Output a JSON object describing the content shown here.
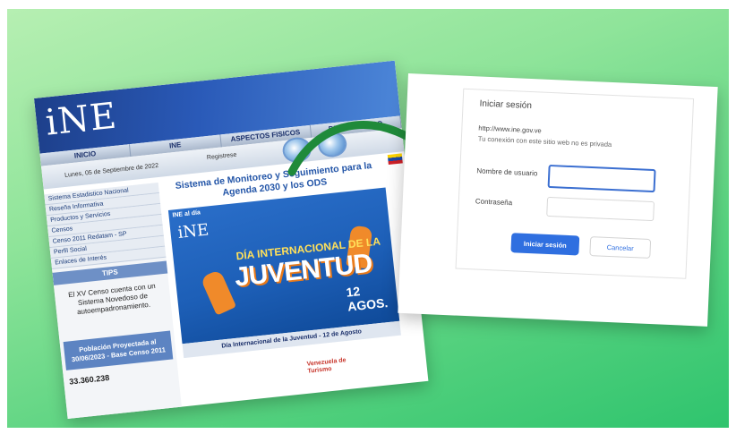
{
  "website": {
    "logo_text": "iNE",
    "nav": [
      "INICIO",
      "INE",
      "ASPECTOS FISICOS",
      "DEMOGRAFICO"
    ],
    "date": "Lunes, 05 de Septiembre de 2022",
    "register": "Registrese",
    "sidebar_links": [
      "Sistema Estadistico Nacional",
      "Reseña Informativa",
      "Productos y Servicios",
      "Censos",
      "Censo 2011 Redatam - SP",
      "Perfil Social",
      "Enlaces de Interés"
    ],
    "tips_title": "TIPS",
    "tips_text": "El XV Censo cuenta con un Sistema Novedoso de autoempadronamiento.",
    "population_title": "Población Proyectada al 30/06/2023 - Base Censo 2011",
    "population_value": "33.360.238",
    "ods_title": "Sistema de Monitoreo y Seguimiento para la Agenda 2030 y los ODS",
    "banner_tag": "INE al día",
    "banner_logo": "iNE",
    "banner_line1": "DÍA INTERNACIONAL DE LA",
    "banner_line2": "JUVENTUD",
    "banner_date": "12 AGOS.",
    "banner_caption": "Día Internacional de la Juventud - 12 de Agosto",
    "tourism_logo": "Venezuela de Turismo"
  },
  "dialog": {
    "title": "Iniciar sesión",
    "url": "http://www.ine.gov.ve",
    "warning": "Tu conexión con este sitio web no es privada",
    "username_label": "Nombre de usuario",
    "username_value": "",
    "password_label": "Contraseña",
    "password_value": "",
    "signin_label": "Iniciar sesión",
    "cancel_label": "Cancelar"
  },
  "colors": {
    "background": "#57d27f",
    "arrow": "#1f8a3a",
    "header_blue": "#1d3f8a",
    "button_blue": "#2f6fe0"
  }
}
